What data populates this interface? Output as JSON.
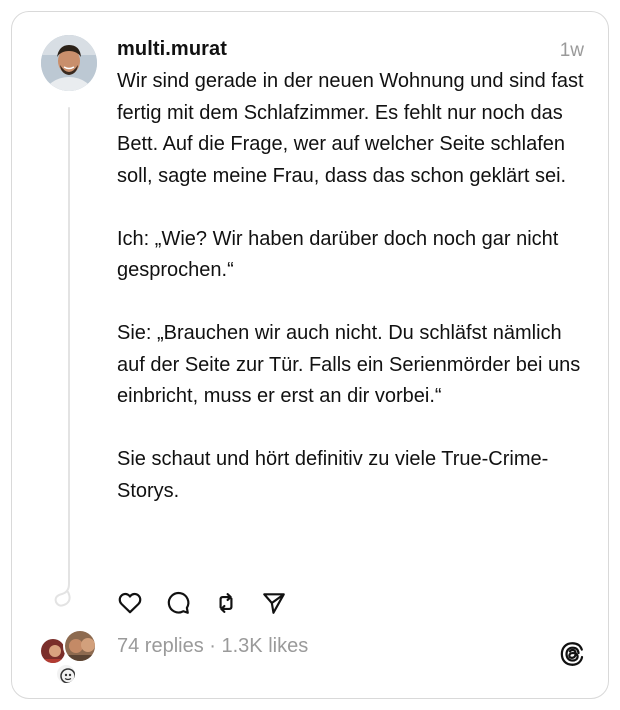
{
  "post": {
    "username": "multi.murat",
    "timestamp": "1w",
    "paragraphs": [
      "Wir sind gerade in der neuen Wohnung und sind fast fertig mit dem Schlafzimmer. Es fehlt nur noch das Bett. Auf die Frage, wer auf welcher Seite schlafen soll, sagte meine Frau, dass das schon geklärt sei.",
      "Ich: „Wie? Wir haben darüber doch noch gar nicht gesprochen.“",
      "Sie: „Brauchen wir auch nicht. Du schläfst nämlich auf der Seite zur Tür. Falls ein Serienmörder bei uns einbricht, muss er erst an dir vorbei.“",
      "Sie schaut und hört definitiv zu viele True-Crime-Storys."
    ]
  },
  "actions": {
    "like_icon": "heart-icon",
    "reply_icon": "comment-icon",
    "repost_icon": "repost-icon",
    "share_icon": "send-icon"
  },
  "stats": {
    "replies": "74 replies",
    "separator": " · ",
    "likes": "1.3K likes"
  },
  "colors": {
    "text": "#111111",
    "muted": "#9a9a9a",
    "border": "#d9d9d9",
    "thread_line": "#e3e3e3"
  }
}
